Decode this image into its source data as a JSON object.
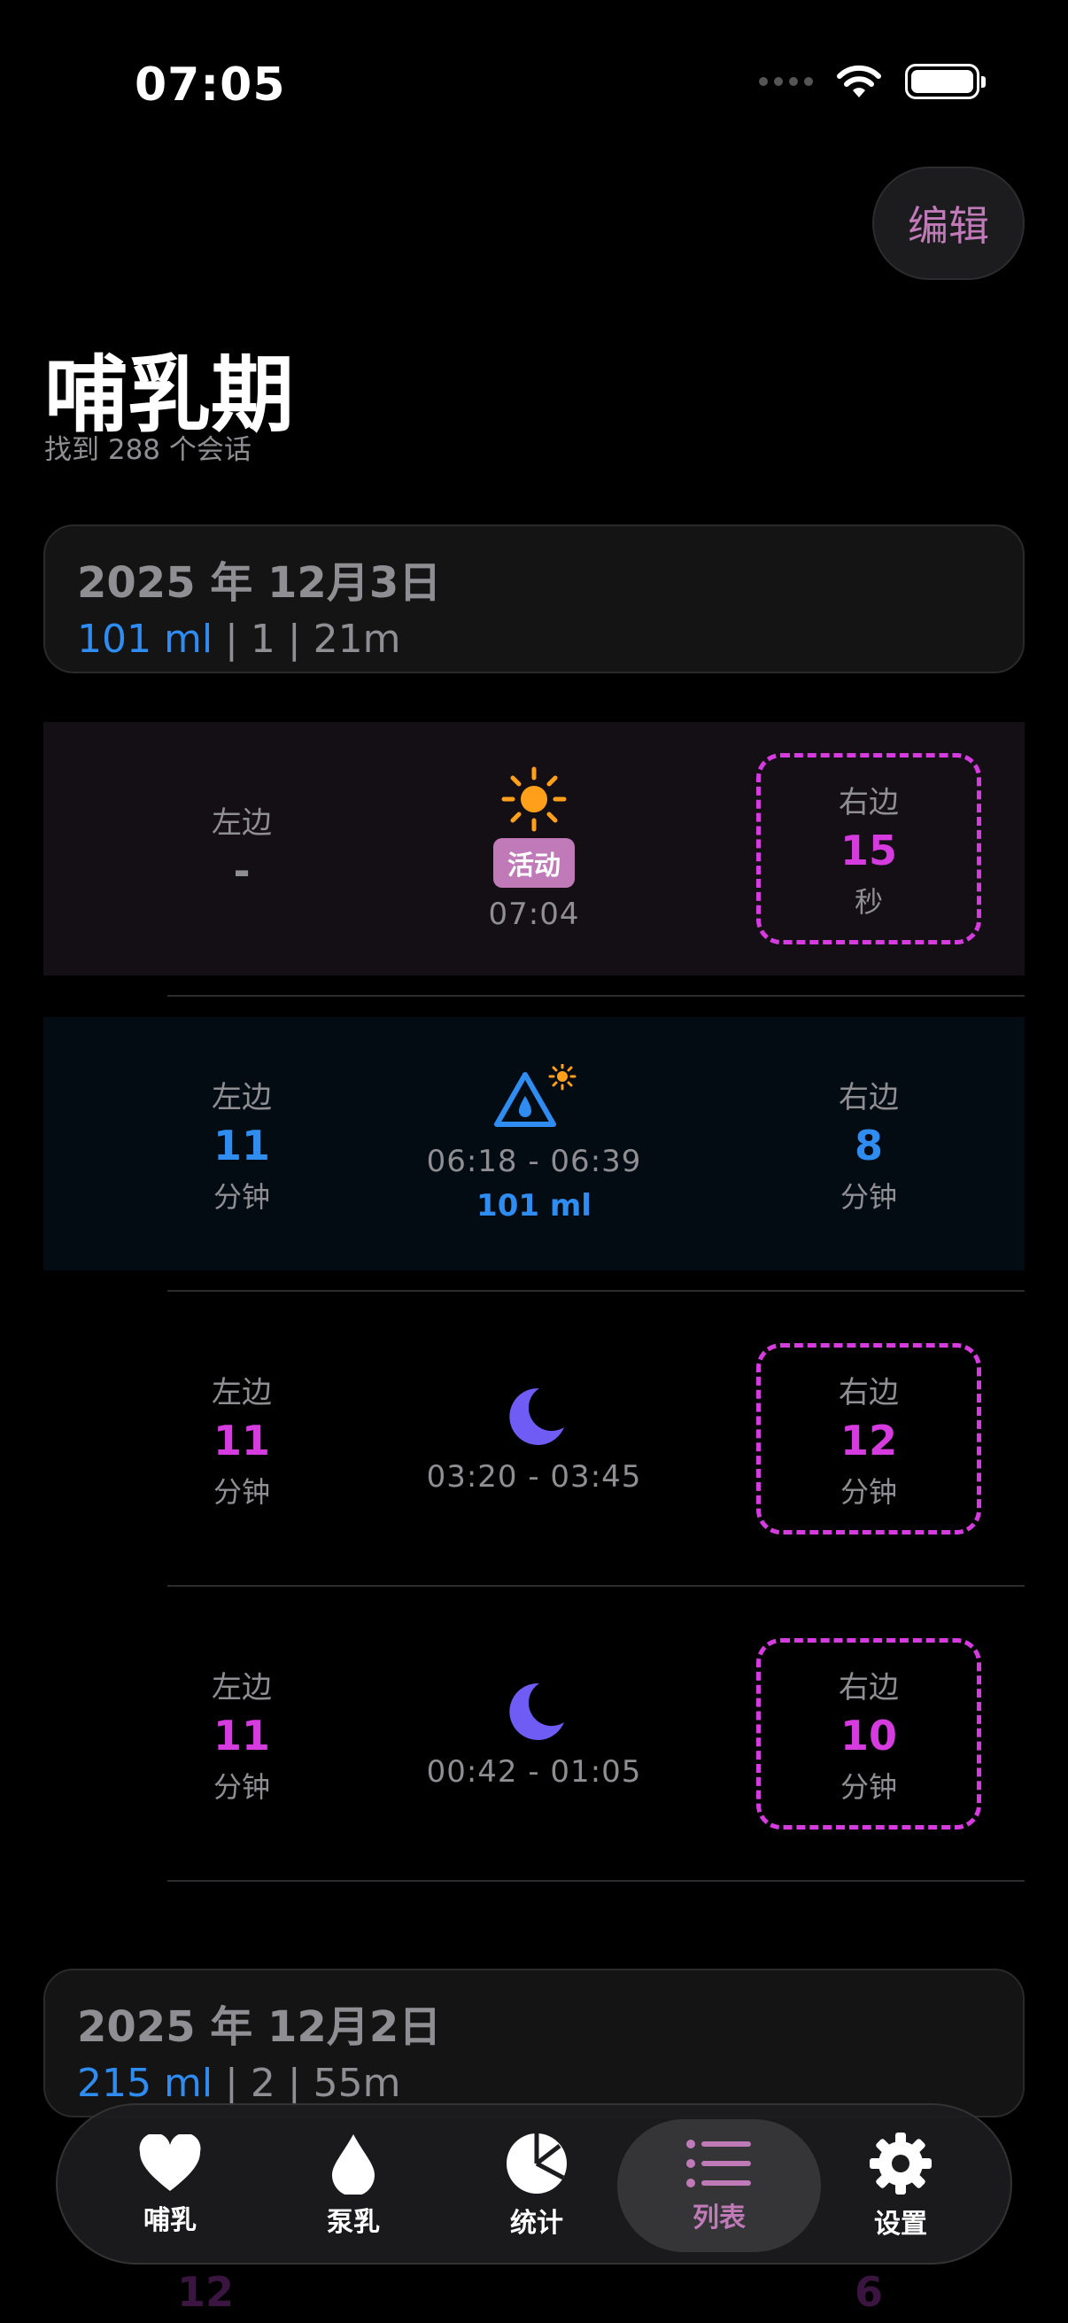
{
  "status_bar": {
    "time": "07:05"
  },
  "header": {
    "edit_label": "编辑",
    "title": "哺乳期",
    "subtitle": "找到 288 个会话"
  },
  "days": [
    {
      "date": "2025 年 12月3日",
      "summary_ml": "101 ml",
      "summary_rest": " | 1 | 21m",
      "sessions": [
        {
          "left_label": "左边",
          "left_value": "-",
          "right_label": "右边",
          "right_value": "15",
          "right_unit": "秒",
          "badge": "活动",
          "time": "07:04"
        },
        {
          "left_label": "左边",
          "left_value": "11",
          "left_unit": "分钟",
          "right_label": "右边",
          "right_value": "8",
          "right_unit": "分钟",
          "time": "06:18 - 06:39",
          "amount": "101 ml"
        },
        {
          "left_label": "左边",
          "left_value": "11",
          "left_unit": "分钟",
          "right_label": "右边",
          "right_value": "12",
          "right_unit": "分钟",
          "time": "03:20 - 03:45"
        },
        {
          "left_label": "左边",
          "left_value": "11",
          "left_unit": "分钟",
          "right_label": "右边",
          "right_value": "10",
          "right_unit": "分钟",
          "time": "00:42 - 01:05"
        }
      ]
    },
    {
      "date": "2025 年 12月2日",
      "summary_ml": "215 ml",
      "summary_rest": " | 2 | 55m",
      "peek_left_value": "12",
      "peek_right_value": "6"
    }
  ],
  "tabs": [
    {
      "label": "哺乳",
      "icon": "heart-icon"
    },
    {
      "label": "泵乳",
      "icon": "drop-icon"
    },
    {
      "label": "统计",
      "icon": "pie-chart-icon"
    },
    {
      "label": "列表",
      "icon": "list-icon"
    },
    {
      "label": "设置",
      "icon": "gear-icon"
    }
  ],
  "colors": {
    "accent": "#c07ab8",
    "magenta": "#d63be0",
    "blue": "#2f8cf0",
    "sun": "#ff9f1a",
    "moon": "#6e5cf5"
  }
}
